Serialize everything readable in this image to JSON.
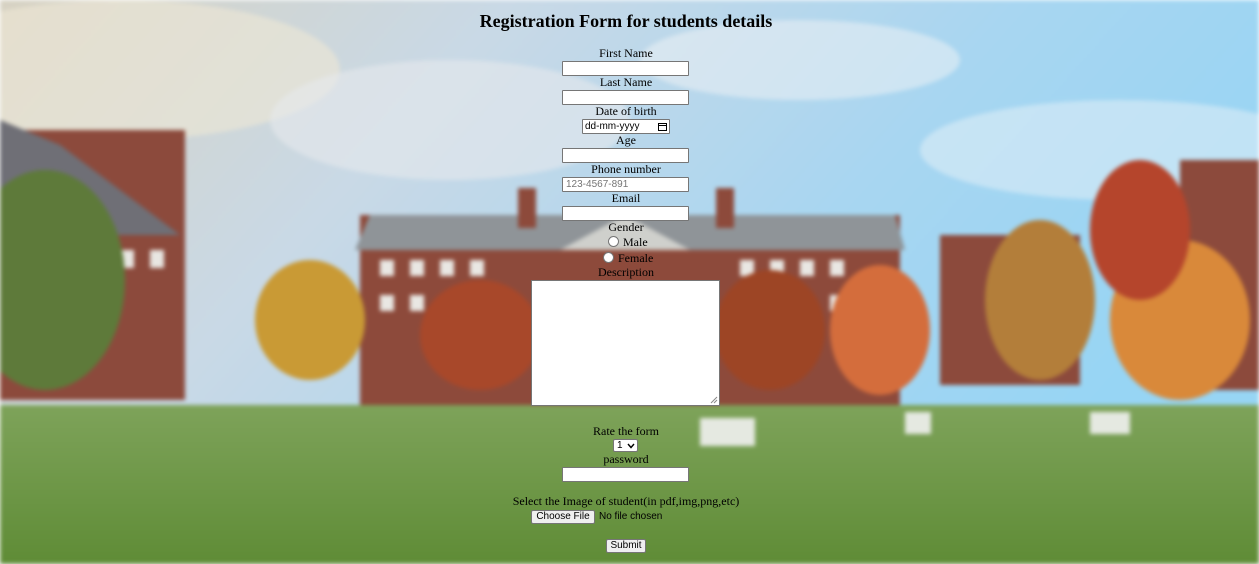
{
  "form": {
    "title": "Registration Form for students details",
    "first_name": {
      "label": "First Name",
      "value": ""
    },
    "last_name": {
      "label": "Last Name",
      "value": ""
    },
    "dob": {
      "label": "Date of birth",
      "value": "dd-mm-yyyy"
    },
    "age": {
      "label": "Age",
      "value": ""
    },
    "phone": {
      "label": "Phone number",
      "placeholder": "123-4567-891",
      "value": ""
    },
    "email": {
      "label": "Email",
      "value": ""
    },
    "gender": {
      "label": "Gender",
      "options": [
        "Male",
        "Female"
      ]
    },
    "description": {
      "label": "Description",
      "value": ""
    },
    "rating": {
      "label": "Rate the form",
      "selected": "1"
    },
    "password": {
      "label": "password",
      "value": ""
    },
    "image": {
      "label": "Select the Image of student(in pdf,img,png,etc)",
      "button": "Choose File",
      "status": "No file chosen"
    },
    "submit_label": "Submit"
  },
  "colors": {
    "sky": "#a9d3ec",
    "grass": "#6f9b45",
    "brick": "#8c4a3c"
  }
}
